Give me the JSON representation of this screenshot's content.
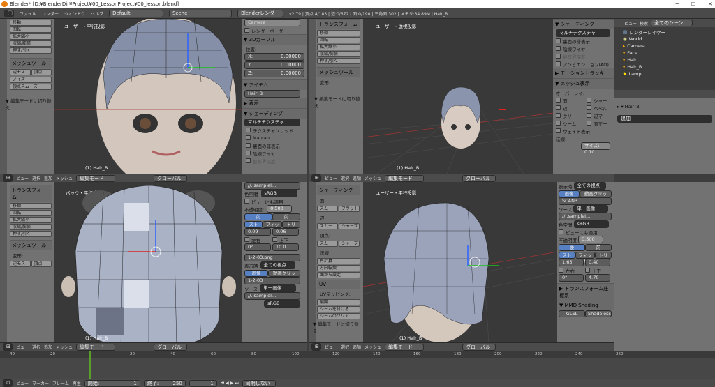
{
  "window": {
    "title": "Blender* [D:¥BlenderDir¥Project¥00_LessonProject¥00_lesson.blend]"
  },
  "menu": {
    "items": [
      "ファイル",
      "レンダー",
      "ウィンドウ",
      "ヘルプ"
    ],
    "layout": "Default",
    "scene": "Scene",
    "engine": "Blenderレンダー",
    "stats": "v2.79 | 頂点:4/183 | 辺:0/372 | 面:0/190 | 三角面:302 | メモリ:34.89M | Hair_B"
  },
  "vp_tl": {
    "label": "ユーザー・平行投影",
    "object": "(1) Hair_B",
    "tools": [
      "移動",
      "回転",
      "拡大縮小",
      "収縮/膨張",
      "押す/引く"
    ],
    "mesh_tools": "メッシュツール",
    "mesh_btns": [
      "辺モス",
      "頂点",
      "ノイズ",
      "頂点スムーズ"
    ],
    "edit_toggle": "▼ 編集モードに切り替え"
  },
  "props_top": {
    "camera": "Camera",
    "render_border": "レンダーボーダー",
    "cursor_title": "3Dカーソル",
    "position": "位置:",
    "xyz": [
      {
        "axis": "X:",
        "val": "0.00000"
      },
      {
        "axis": "Y:",
        "val": "0.00000"
      },
      {
        "axis": "Z:",
        "val": "0.00000"
      }
    ],
    "item_title": "アイテム",
    "item_name": "Hair_B",
    "display": "表示",
    "shading": "シェーディング",
    "shading_mode": "マルチテクスチャ",
    "options": [
      "テクスチャソリッド",
      "Matcap",
      "裏面の非表示",
      "陰線ワイヤ",
      "被写界深度"
    ]
  },
  "vp_tr": {
    "label": "ユーザー・透視投影",
    "object": "(1) Hair_B",
    "transform": "トランスフォーム",
    "tools": [
      "移動",
      "回転",
      "拡大縮小",
      "収縮/膨張",
      "押す/引く"
    ],
    "mesh_tools": "メッシュツール",
    "deform": "変形:",
    "edit_toggle": "▼ 編集モードに切り替え"
  },
  "props_right": {
    "shading": "シェーディング",
    "shading_mode": "マルチテクスチャ",
    "opts": [
      "裏面の非表示",
      "陰線ワイヤ",
      "被写界深度",
      "アンビエン...ョン(AO)"
    ],
    "motion_track": "モーショントラッキ",
    "mesh_display": "メッシュ表示",
    "overlay": "オーバーレイ:",
    "overlay_items": [
      [
        "面",
        "シャー"
      ],
      [
        "辺",
        "ベベル"
      ],
      [
        "クリー",
        "辺マー"
      ],
      [
        "シーム",
        "面マー"
      ]
    ],
    "weight": "ウェイト表示",
    "normals": "法線:",
    "size": "サイズ: 0.10"
  },
  "outliner": {
    "view": "ビュー",
    "search": "検索",
    "filter": "全てのシーン",
    "items": [
      "レンダーレイヤー",
      "World",
      "Camera",
      "Face",
      "Hair",
      "Hair_B",
      "Lamp"
    ],
    "selected": "Hair_B",
    "add": "追加"
  },
  "header_tl": {
    "items": [
      "ビュー",
      "選択",
      "追加",
      "メッシュ"
    ],
    "mode": "編集モード",
    "orient": "グローバル"
  },
  "header_tr": {
    "items": [
      "ビュー",
      "選択",
      "追加",
      "メッシュ"
    ],
    "mode": "編集モード",
    "orient": "グローバル"
  },
  "vp_bl": {
    "label": "バック・平行投影",
    "object": "(1) Hair_B",
    "transform": "トランスフォーム",
    "tools": [
      "移動",
      "回転",
      "拡大縮小",
      "収縮/膨張",
      "押す/引く"
    ],
    "mesh_tools": "メッシュツール",
    "deform": "変形:",
    "mesh_btns": [
      "辺モス",
      "頂点"
    ]
  },
  "img_panel": {
    "file": "//..sampleI...",
    "colorspace_label": "色空間",
    "colorspace": "sRGB",
    "view_as": "ビューにも適用",
    "opacity_label": "不透明度:",
    "opacity": "0.500",
    "tabs": [
      "前",
      "前"
    ],
    "fit": [
      "ストレ",
      "フィット",
      "トリム"
    ],
    "vals": [
      "0.09",
      "0.06"
    ],
    "lr": [
      "左右",
      "上下"
    ],
    "rot": [
      "0°",
      "10.0"
    ],
    "img2": "1-2-03.png",
    "display_label": "表示時",
    "display": "全ての視点",
    "src_tabs": [
      "画像",
      "動画クリップ"
    ],
    "img2b": "1-2-03",
    "source_label": "ソース",
    "source": "単一画像",
    "file2": "//..sampleI...",
    "colorspace2": "sRGB"
  },
  "shade_panel": {
    "title": "シェーディング",
    "face": "面:",
    "face_btns": [
      "スムー",
      "フラット"
    ],
    "edge": "辺:",
    "edge_btns": [
      "スムー",
      "シャープ"
    ],
    "vert": "頂点:",
    "vert_btns": [
      "スムー",
      "シャープ"
    ],
    "normals": "法線",
    "normal_btns": [
      "再計算",
      "方向転換",
      "面から設定"
    ],
    "uv": "UV",
    "uv_map": "UVマッピング:",
    "unwrap": "展開",
    "seam_btns": [
      "シームを付ける",
      "シームのクリア"
    ],
    "edit_toggle": "▼ 編集モードに切り替え"
  },
  "vp_br": {
    "label": "ユーザー・平行投影",
    "object": "(1) Hair_B"
  },
  "props_br": {
    "display_label": "表示時",
    "display": "全ての視点",
    "src_tabs": [
      "画像",
      "動画クリップ"
    ],
    "img": "SCAN3",
    "source_label": "ソース",
    "source": "単一画像",
    "file": "//..sampleI...",
    "colorspace_label": "色空間",
    "colorspace": "sRGB",
    "view_as": "ビューにも適用",
    "opacity_label": "不透明度",
    "opacity": "0.500",
    "tabs": [
      "後",
      "前"
    ],
    "fit": [
      "ストレ",
      "フィット",
      "トリム"
    ],
    "vals": [
      "1.65",
      "0.40"
    ],
    "lr": [
      "左右",
      "上下"
    ],
    "rot": [
      "0°",
      "4.70"
    ],
    "transform_orient": "トランスフォーム座標系",
    "mmd": "MMD Shading",
    "glsl": "GLSL",
    "shadeless": "Shadeless"
  },
  "header_bl": {
    "items": [
      "ビュー",
      "選択",
      "追加",
      "メッシュ"
    ],
    "mode": "編集モード",
    "orient": "グローバル"
  },
  "header_br": {
    "items": [
      "ビュー",
      "選択",
      "追加",
      "メッシュ"
    ],
    "mode": "編集モード",
    "orient": "グローバル"
  },
  "timeline": {
    "ticks": [
      "-40",
      "-20",
      "0",
      "20",
      "40",
      "60",
      "80",
      "100",
      "120",
      "140",
      "160",
      "180",
      "200",
      "220",
      "240",
      "260"
    ],
    "menu": [
      "ビュー",
      "マーカー",
      "フレーム",
      "再生"
    ],
    "start_label": "開始:",
    "start": "1",
    "end_label": "終了:",
    "end": "250",
    "current": "1",
    "sync": "同期しない"
  }
}
